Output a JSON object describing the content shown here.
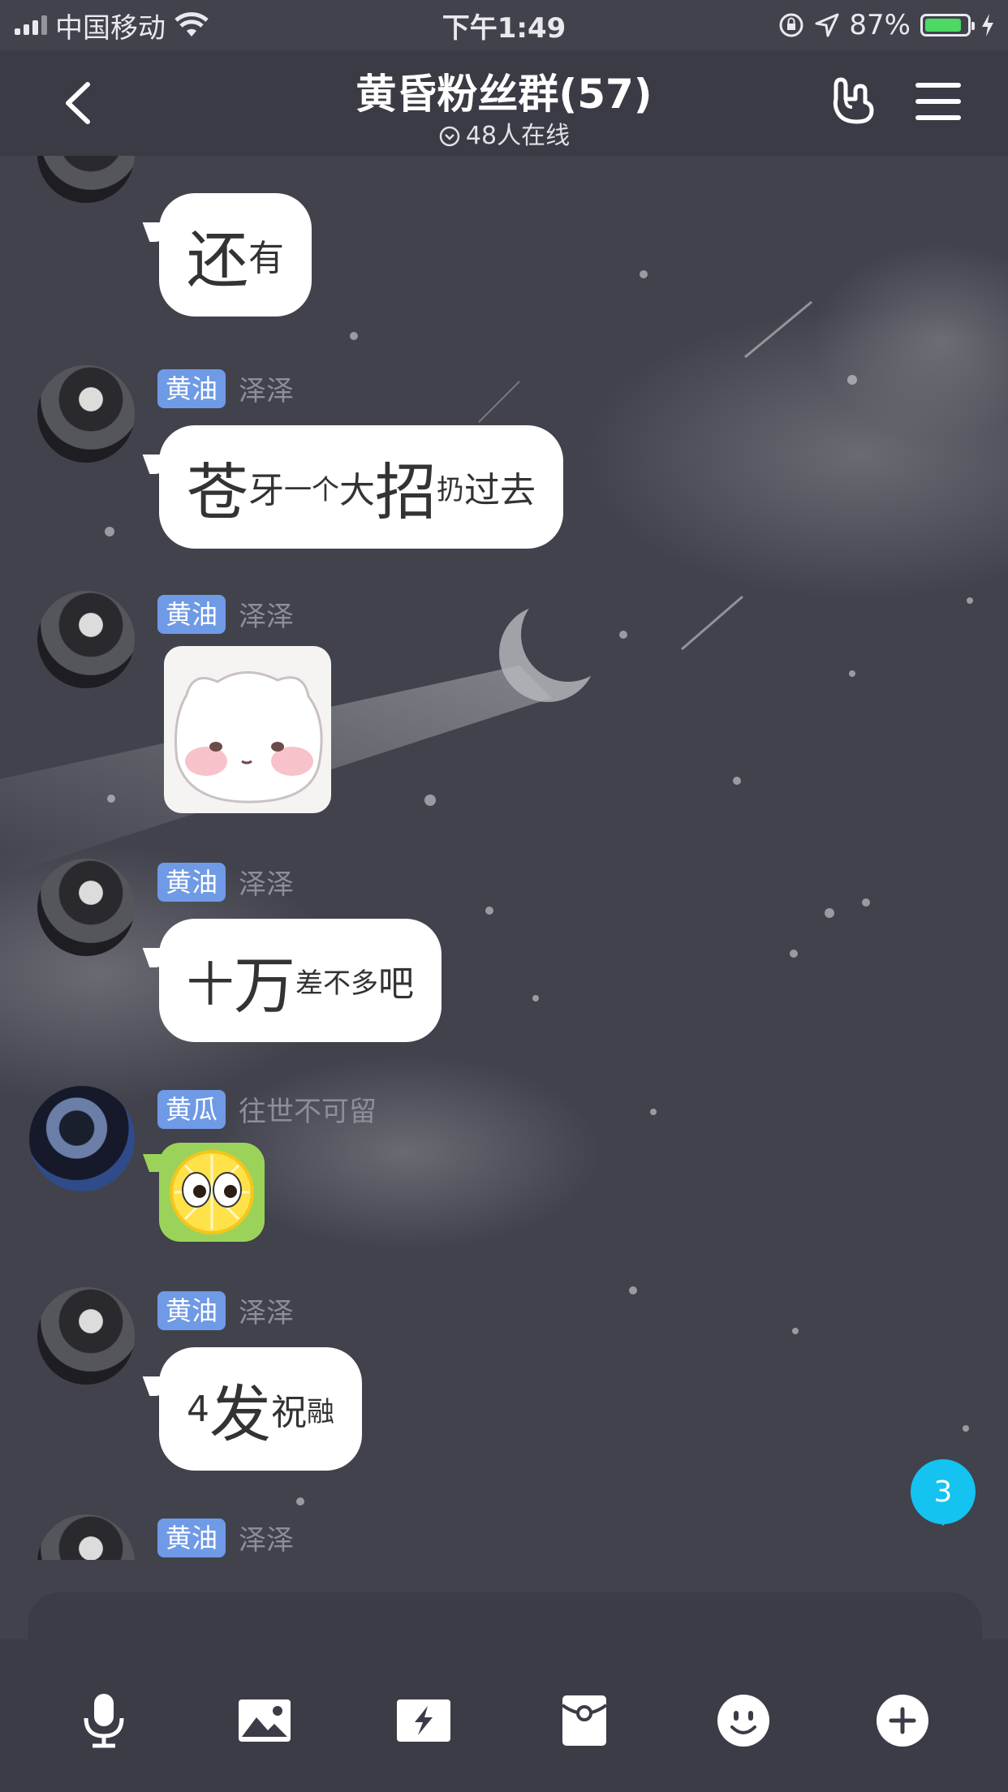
{
  "status_bar": {
    "carrier": "中国移动",
    "time": "下午1:49",
    "battery_percent": "87%",
    "battery_level": 0.87
  },
  "header": {
    "title": "黄昏粉丝群(57)",
    "online": "48人在线"
  },
  "messages": [
    {
      "badge": "黄油",
      "nick": "泽泽",
      "parts": [
        {
          "t": "还",
          "s": "t-xl"
        },
        {
          "t": "有",
          "s": "t-m"
        }
      ]
    },
    {
      "badge": "黄油",
      "nick": "泽泽",
      "parts": [
        {
          "t": "苍",
          "s": "t-xl"
        },
        {
          "t": "牙",
          "s": "t-m"
        },
        {
          "t": "一个",
          "s": "t-s"
        },
        {
          "t": "大",
          "s": "t-m"
        },
        {
          "t": "招",
          "s": "t-xl"
        },
        {
          "t": "扔",
          "s": "t-s"
        },
        {
          "t": "过去",
          "s": "t-m"
        }
      ]
    },
    {
      "badge": "黄油",
      "nick": "泽泽",
      "sticker": "bear-sticker"
    },
    {
      "badge": "黄油",
      "nick": "泽泽",
      "parts": [
        {
          "t": "十",
          "s": "t-l"
        },
        {
          "t": "万",
          "s": "t-xl"
        },
        {
          "t": "差不多",
          "s": "t-s"
        },
        {
          "t": "吧",
          "s": "t-m"
        }
      ]
    },
    {
      "badge": "黄瓜",
      "nick": "往世不可留",
      "sticker": "lemon-sticker"
    },
    {
      "badge": "黄油",
      "nick": "泽泽",
      "parts": [
        {
          "t": "4",
          "s": "t-m"
        },
        {
          "t": "发",
          "s": "t-xl"
        },
        {
          "t": "祝",
          "s": "t-m"
        },
        {
          "t": "融",
          "s": "t-s"
        }
      ]
    },
    {
      "badge": "黄油",
      "nick": "泽泽"
    }
  ],
  "unread_count": "3",
  "toolbar": {
    "icons": [
      "microphone-icon",
      "image-icon",
      "lightning-icon",
      "red-packet-icon",
      "emoji-icon",
      "plus-icon"
    ]
  },
  "colors": {
    "badge": "#6f9ae6",
    "unread": "#14c3ef",
    "background": "#41424c",
    "battery": "#4cd964"
  }
}
